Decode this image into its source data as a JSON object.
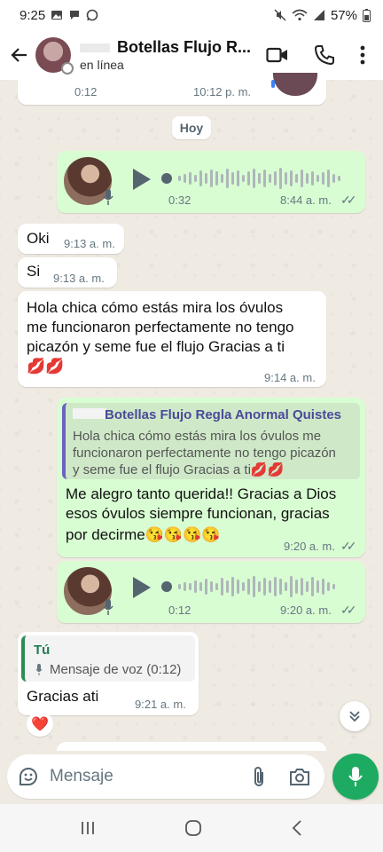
{
  "status_bar": {
    "time": "9:25",
    "battery": "57%"
  },
  "header": {
    "contact_name": "Botellas Flujo R...",
    "status": "en línea"
  },
  "chat": {
    "prev_partial": {
      "duration": "0:12",
      "time": "10:12 p. m."
    },
    "date_chip": "Hoy",
    "voice1": {
      "duration": "0:32",
      "time": "8:44 a. m."
    },
    "msg_oki": {
      "text": "Oki",
      "time": "9:13 a. m."
    },
    "msg_si": {
      "text": "Si",
      "time": "9:13 a. m."
    },
    "msg_long": {
      "line1": "Hola chica cómo estás mira los óvulos",
      "line2": "me funcionaron perfectamente no tengo",
      "line3": "picazón y seme fue el flujo Gracias a ti",
      "emoji": "💋💋",
      "time": "9:14 a. m."
    },
    "reply_out": {
      "quote_name": "Botellas Flujo Regla Anormal Quistes",
      "quote_line1": "Hola chica cómo estás mira los óvulos me",
      "quote_line2": "funcionaron perfectamente no tengo picazón",
      "quote_line3": "y seme fue el flujo Gracias a ti💋💋",
      "line1": "Me alegro tanto querida!! Gracias a Dios",
      "line2": "esos óvulos siempre funcionan, gracias",
      "line3": "por decirme😘😘😘😘",
      "time": "9:20 a. m."
    },
    "voice2": {
      "duration": "0:12",
      "time": "9:20 a. m."
    },
    "reply_in": {
      "quote_name": "Tú",
      "quote_text": "Mensaje de voz (0:12)",
      "text": "Gracias ati",
      "time": "9:21 a. m.",
      "reaction": "❤️"
    }
  },
  "composer": {
    "placeholder": "Mensaje"
  },
  "colors": {
    "outgoing": "#d9fdd3",
    "incoming": "#ffffff",
    "accent": "#1daa61",
    "background": "#efeae2"
  }
}
